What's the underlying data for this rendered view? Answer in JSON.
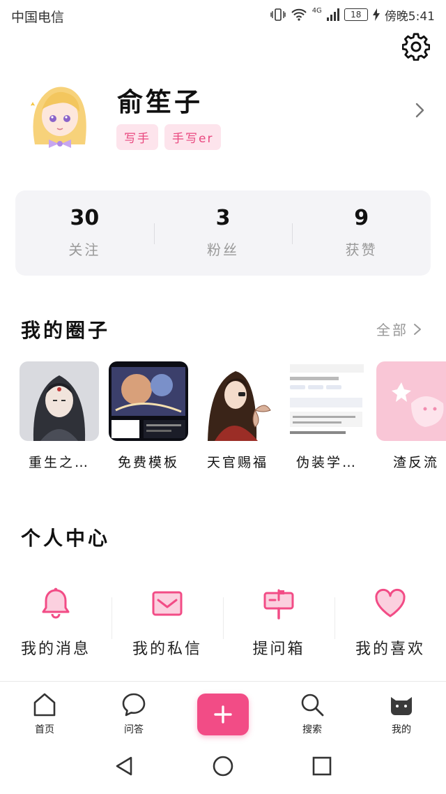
{
  "status_bar": {
    "carrier": "中国电信",
    "network": "4G",
    "battery": "18",
    "time": "傍晚5:41"
  },
  "profile": {
    "username": "俞笙子",
    "badges": [
      "写手",
      "手写er"
    ]
  },
  "stats": [
    {
      "value": "30",
      "label": "关注"
    },
    {
      "value": "3",
      "label": "粉丝"
    },
    {
      "value": "9",
      "label": "获赞"
    }
  ],
  "my_circles": {
    "title": "我的圈子",
    "see_all": "全部",
    "items": [
      {
        "name": "重生之…"
      },
      {
        "name": "免费模板"
      },
      {
        "name": "天官赐福"
      },
      {
        "name": "伪装学…"
      },
      {
        "name": "渣反流"
      }
    ]
  },
  "personal_center": {
    "title": "个人中心",
    "items": [
      {
        "label": "我的消息",
        "icon": "bell-icon"
      },
      {
        "label": "我的私信",
        "icon": "mail-icon"
      },
      {
        "label": "提问箱",
        "icon": "mailbox-icon"
      },
      {
        "label": "我的喜欢",
        "icon": "heart-icon"
      }
    ]
  },
  "tabbar": {
    "home": "首页",
    "qa": "问答",
    "search": "搜索",
    "mine": "我的"
  },
  "colors": {
    "accent": "#f24c86",
    "badge_bg": "#fde4ec",
    "card_bg": "#f4f4f7"
  }
}
